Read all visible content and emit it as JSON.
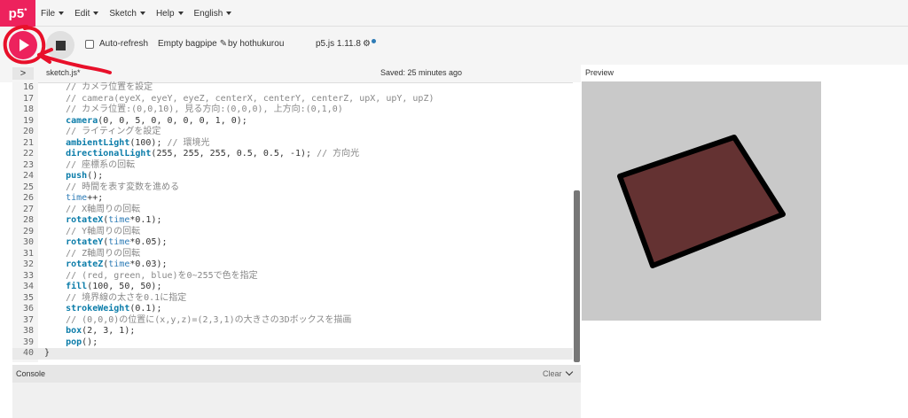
{
  "nav": {
    "logo": "p5",
    "logo_sup": "*",
    "menus": [
      "File",
      "Edit",
      "Sketch",
      "Help",
      "English"
    ]
  },
  "toolbar": {
    "auto_refresh_label": "Auto-refresh",
    "sketch_name": "Empty bagpipe",
    "by_author": "by hothukurou",
    "version": "p5.js 1.11.8"
  },
  "filebar": {
    "filename": "sketch.js*",
    "saved": "Saved: 25 minutes ago",
    "preview_label": "Preview",
    "expander_glyph": ">"
  },
  "editor": {
    "lines": [
      {
        "n": "16",
        "parts": [
          {
            "t": "    // カメラ位置を設定",
            "c": "comment"
          }
        ]
      },
      {
        "n": "17",
        "parts": [
          {
            "t": "    // camera(eyeX, eyeY, eyeZ, centerX, centerY, centerZ, upX, upY, upZ)",
            "c": "comment"
          }
        ]
      },
      {
        "n": "18",
        "parts": [
          {
            "t": "    // カメラ位置:(0,0,10), 見る方向:(0,0,0), 上方向:(0,1,0)",
            "c": "comment"
          }
        ]
      },
      {
        "n": "19",
        "parts": [
          {
            "t": "    ",
            "c": "plain"
          },
          {
            "t": "camera",
            "c": "fn"
          },
          {
            "t": "(0, 0, 5, 0, 0, 0, 0, 1, 0);",
            "c": "plain"
          }
        ]
      },
      {
        "n": "20",
        "parts": [
          {
            "t": "    // ライティングを設定",
            "c": "comment"
          }
        ]
      },
      {
        "n": "21",
        "parts": [
          {
            "t": "    ",
            "c": "plain"
          },
          {
            "t": "ambientLight",
            "c": "fn"
          },
          {
            "t": "(100); ",
            "c": "plain"
          },
          {
            "t": "// 環境光",
            "c": "comment"
          }
        ]
      },
      {
        "n": "22",
        "parts": [
          {
            "t": "    ",
            "c": "plain"
          },
          {
            "t": "directionalLight",
            "c": "fn"
          },
          {
            "t": "(255, 255, 255, 0.5, 0.5, -1); ",
            "c": "plain"
          },
          {
            "t": "// 方向光",
            "c": "comment"
          }
        ]
      },
      {
        "n": "23",
        "parts": [
          {
            "t": "    // 座標系の回転",
            "c": "comment"
          }
        ]
      },
      {
        "n": "24",
        "parts": [
          {
            "t": "    ",
            "c": "plain"
          },
          {
            "t": "push",
            "c": "fn"
          },
          {
            "t": "();",
            "c": "plain"
          }
        ]
      },
      {
        "n": "25",
        "parts": [
          {
            "t": "    // 時間を表す変数を進める",
            "c": "comment"
          }
        ]
      },
      {
        "n": "26",
        "parts": [
          {
            "t": "    ",
            "c": "plain"
          },
          {
            "t": "time",
            "c": "var"
          },
          {
            "t": "++;",
            "c": "plain"
          }
        ]
      },
      {
        "n": "27",
        "parts": [
          {
            "t": "    // X軸周りの回転",
            "c": "comment"
          }
        ]
      },
      {
        "n": "28",
        "parts": [
          {
            "t": "    ",
            "c": "plain"
          },
          {
            "t": "rotateX",
            "c": "fn"
          },
          {
            "t": "(",
            "c": "plain"
          },
          {
            "t": "time",
            "c": "var"
          },
          {
            "t": "*0.1);",
            "c": "plain"
          }
        ]
      },
      {
        "n": "29",
        "parts": [
          {
            "t": "    // Y軸周りの回転",
            "c": "comment"
          }
        ]
      },
      {
        "n": "30",
        "parts": [
          {
            "t": "    ",
            "c": "plain"
          },
          {
            "t": "rotateY",
            "c": "fn"
          },
          {
            "t": "(",
            "c": "plain"
          },
          {
            "t": "time",
            "c": "var"
          },
          {
            "t": "*0.05);",
            "c": "plain"
          }
        ]
      },
      {
        "n": "31",
        "parts": [
          {
            "t": "    // Z軸周りの回転",
            "c": "comment"
          }
        ]
      },
      {
        "n": "32",
        "parts": [
          {
            "t": "    ",
            "c": "plain"
          },
          {
            "t": "rotateZ",
            "c": "fn"
          },
          {
            "t": "(",
            "c": "plain"
          },
          {
            "t": "time",
            "c": "var"
          },
          {
            "t": "*0.03);",
            "c": "plain"
          }
        ]
      },
      {
        "n": "33",
        "parts": [
          {
            "t": "    // (red, green, blue)を0~255で色を指定",
            "c": "comment"
          }
        ]
      },
      {
        "n": "34",
        "parts": [
          {
            "t": "    ",
            "c": "plain"
          },
          {
            "t": "fill",
            "c": "fn"
          },
          {
            "t": "(100, 50, 50);",
            "c": "plain"
          }
        ]
      },
      {
        "n": "35",
        "parts": [
          {
            "t": "    // 境界線の太さを0.1に指定",
            "c": "comment"
          }
        ]
      },
      {
        "n": "36",
        "parts": [
          {
            "t": "    ",
            "c": "plain"
          },
          {
            "t": "strokeWeight",
            "c": "fn"
          },
          {
            "t": "(0.1);",
            "c": "plain"
          }
        ]
      },
      {
        "n": "37",
        "parts": [
          {
            "t": "    // (0,0,0)の位置に(x,y,z)=(2,3,1)の大きさの3Dボックスを描画",
            "c": "comment"
          }
        ]
      },
      {
        "n": "38",
        "parts": [
          {
            "t": "    ",
            "c": "plain"
          },
          {
            "t": "box",
            "c": "fn"
          },
          {
            "t": "(2, 3, 1);",
            "c": "plain"
          }
        ]
      },
      {
        "n": "39",
        "parts": [
          {
            "t": "    ",
            "c": "plain"
          },
          {
            "t": "pop",
            "c": "fn"
          },
          {
            "t": "();",
            "c": "plain"
          }
        ]
      },
      {
        "n": "40",
        "parts": [
          {
            "t": "}",
            "c": "plain"
          }
        ],
        "active": true
      }
    ]
  },
  "console": {
    "label": "Console",
    "clear_label": "Clear"
  },
  "colors": {
    "accent": "#ed225d",
    "box_fill": "#643232",
    "box_stroke": "#000000",
    "preview_bg": "#c9c9c9",
    "scribble": "#e8102a"
  },
  "icons": {
    "play": "play-icon",
    "stop": "stop-icon",
    "pencil": "pencil-icon",
    "gear": "gear-icon",
    "chevron": "chevron-down-icon"
  }
}
